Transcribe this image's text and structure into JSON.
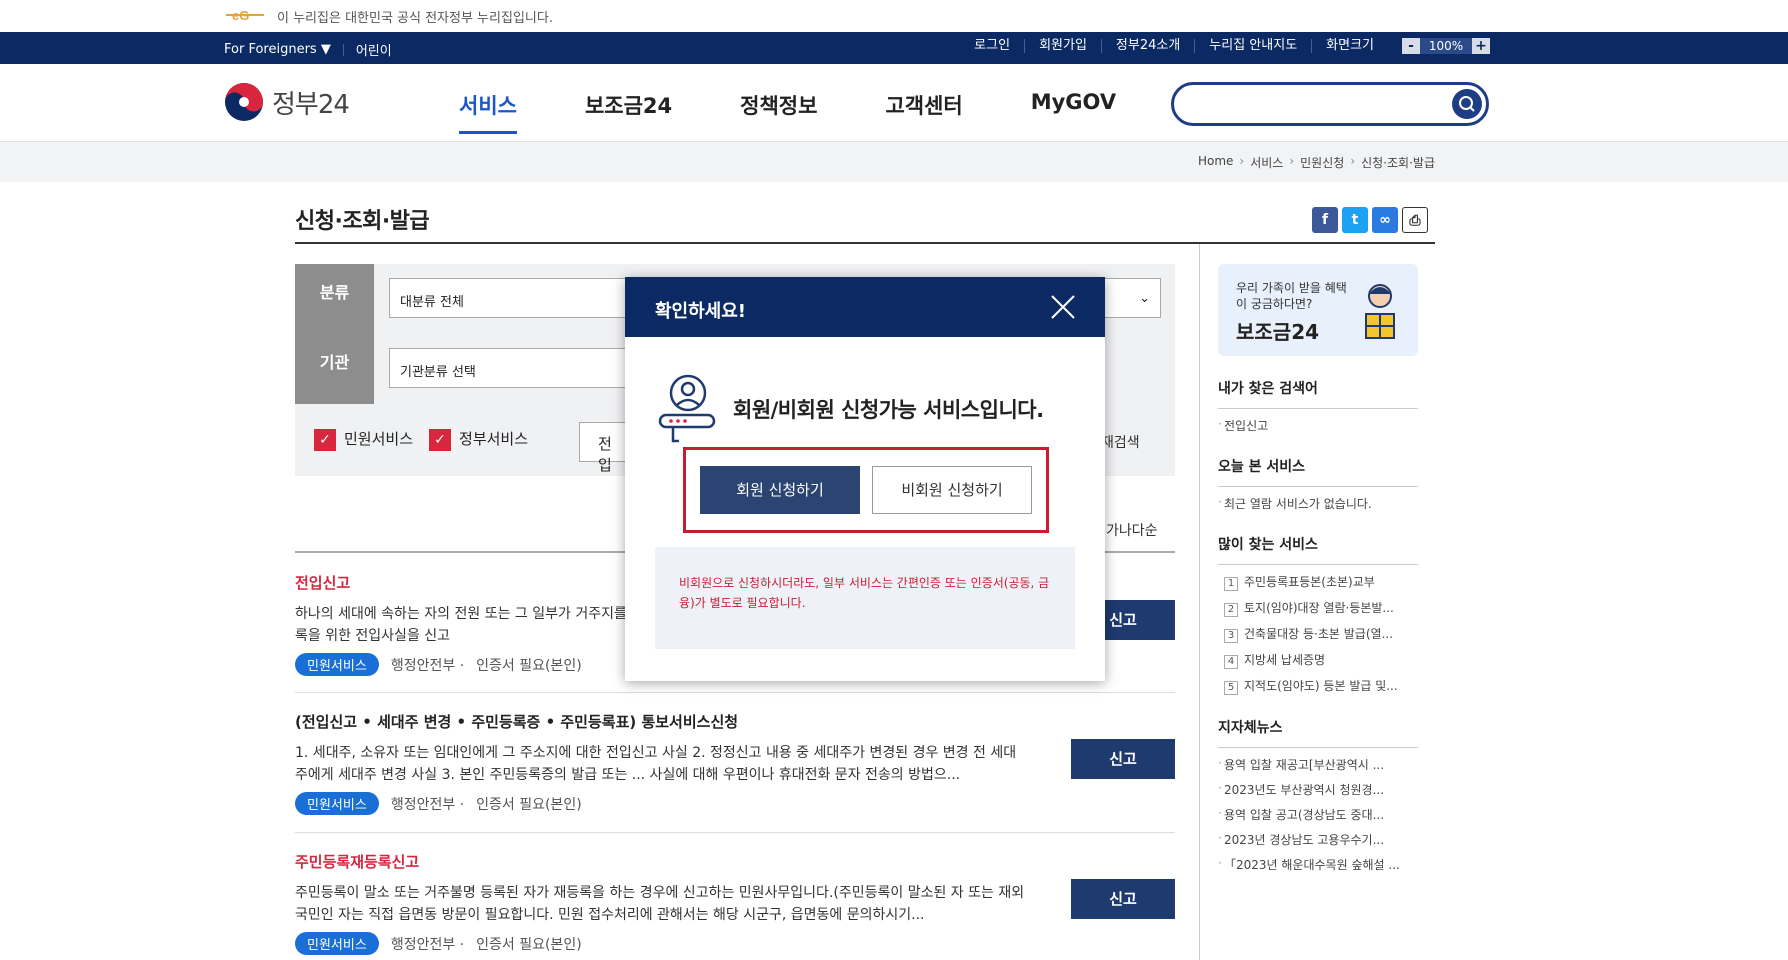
{
  "gov_notice": "이 누리집은 대한민국 공식 전자정부 누리집입니다.",
  "util": {
    "left": [
      "For Foreigners ▼",
      "어린이"
    ],
    "right": [
      "로그인",
      "회원가입",
      "정부24소개",
      "누리집 안내지도"
    ],
    "zoom_label": "화면크기",
    "zoom_minus": "-",
    "zoom_value": "100%",
    "zoom_plus": "+"
  },
  "logo_text": "정부24",
  "menu": [
    "서비스",
    "보조금24",
    "정책정보",
    "고객센터",
    "MyGOV"
  ],
  "search": {
    "value": ""
  },
  "breadcrumb": [
    "Home",
    "서비스",
    "민원신청",
    "신청·조회·발급"
  ],
  "page_title": "신청·조회·발급",
  "filter": {
    "category_label": "분류",
    "category_value": "대분류 전체",
    "agency_label": "기관",
    "agency_value": "기관분류 선택",
    "check1": "민원서비스",
    "check2": "정부서비스",
    "keyword": "전입",
    "research": "재검색",
    "sort": "가나다순"
  },
  "items": [
    {
      "title_parts": [
        "전입신고"
      ],
      "desc": "하나의 세대에 속하는 자의 전원 또는 그 일부가 거주지를 이동하면 신거주지에 전입한 날부터 14일 이내에 주소지변경 및 등록을 위한 전입사실을 신고",
      "badge": "민원서비스",
      "agency": "행정안전부 ·",
      "cert": "인증서 필요(본인)",
      "apply": "신고"
    },
    {
      "title": "(전입신고 • 세대주 변경 • 주민등록증 • 주민등록표) 통보서비스신청",
      "desc": "1. 세대주, 소유자 또는 임대인에게 그 주소지에 대한 전입신고 사실 2. 정정신고 내용 중 세대주가 변경된 경우 변경 전 세대주에게 세대주 변경 사실 3. 본인 주민등록증의 발급 또는 ... 사실에 대해 우편이나 휴대전화 문자 전송의 방법으...",
      "badge": "민원서비스",
      "agency": "행정안전부 ·",
      "cert": "인증서 필요(본인)",
      "apply": "신고"
    },
    {
      "title": "주민등록재등록신고",
      "desc": "주민등록이 말소 또는 거주불명 등록된 자가 재등록을 하는 경우에 신고하는 민원사무입니다.(주민등록이 말소된 자 또는 재외국민인 자는 직접 읍면동 방문이 필요합니다. 민원 접수처리에 관해서는 해당 시군구, 읍면동에 문의하시기...",
      "badge": "민원서비스",
      "agency": "행정안전부 ·",
      "cert": "인증서 필요(본인)",
      "apply": "신고"
    }
  ],
  "aside": {
    "banner_line": "우리 가족이 받을 혜택이 궁금하다면?",
    "banner_title": "보조금24",
    "recent_search_title": "내가 찾은 검색어",
    "recent_search": [
      "전입신고"
    ],
    "today_title": "오늘 본 서비스",
    "today": [
      "최근 열람 서비스가 없습니다."
    ],
    "popular_title": "많이 찾는 서비스",
    "popular": [
      "주민등록표등본(초본)교부",
      "토지(임야)대장 열람·등본발...",
      "건축물대장 등·초본 발급(열...",
      "지방세 납세증명",
      "지적도(임야도) 등본 발급 및..."
    ],
    "news_title": "지자체뉴스",
    "news": [
      "용역 입찰 재공고[부산광역시 ...",
      "2023년도 부산광역시 청원경...",
      "용역 입찰 공고(경상남도 중대...",
      "2023년 경상남도 고용우수기...",
      "「2023년 해운대수목원 숲해설 ..."
    ]
  },
  "modal": {
    "title": "확인하세요!",
    "message": "회원/비회원 신청가능 서비스입니다.",
    "member_button": "회원 신청하기",
    "guest_button": "비회원 신청하기",
    "note": "비회원으로 신청하시더라도, 일부 서비스는 간편인증 또는 인증서(공동, 금융)가 별도로 필요합니다."
  },
  "colors": {
    "navy": "#0b2a64",
    "accent": "#1a57c8",
    "red": "#c81d2e",
    "badge": "#1a6fd6"
  }
}
